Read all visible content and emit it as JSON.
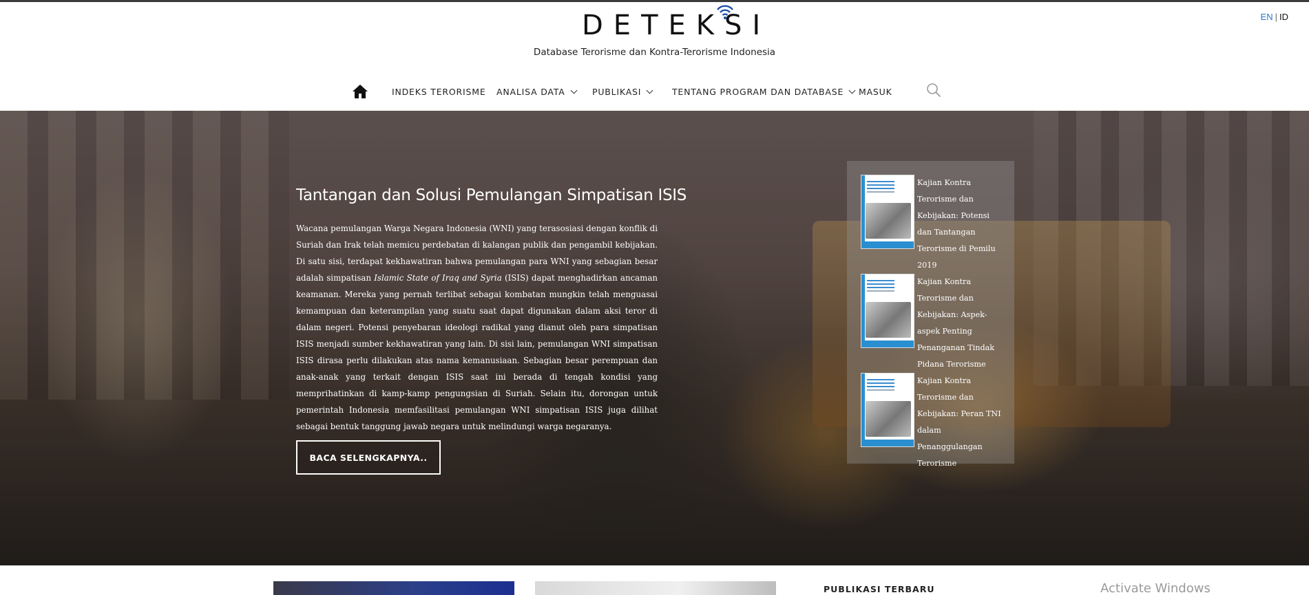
{
  "header": {
    "logo_text": "DETEKSI",
    "tagline": "Database Terorisme dan Kontra-Terorisme Indonesia",
    "lang_en": "EN",
    "lang_sep": "|",
    "lang_id": "ID"
  },
  "nav": {
    "home_icon": "home-icon",
    "items": [
      {
        "label": "INDEKS TERORISME",
        "dropdown": false
      },
      {
        "label": "ANALISA DATA",
        "dropdown": true
      },
      {
        "label": "PUBLIKASI",
        "dropdown": true
      },
      {
        "label": "TENTANG PROGRAM DAN DATABASE",
        "dropdown": true
      },
      {
        "label": "MASUK",
        "dropdown": false
      }
    ],
    "search_icon": "search-icon"
  },
  "hero": {
    "title": "Tantangan dan Solusi Pemulangan Simpatisan ISIS",
    "body_part1": "Wacana pemulangan Warga Negara Indonesia (WNI) yang terasosiasi dengan konflik di Suriah dan Irak telah memicu perdebatan di kalangan publik dan pengambil kebijakan. Di satu sisi, terdapat kekhawatiran bahwa pemulangan para WNI yang sebagian besar adalah simpatisan ",
    "body_italic": "Islamic State of Iraq and Syria",
    "body_part2": " (ISIS) dapat menghadirkan ancaman keamanan. Mereka yang pernah terlibat sebagai kombatan mungkin telah menguasai kemampuan dan keterampilan yang suatu saat dapat digunakan dalam aksi teror di dalam negeri. Potensi penyebaran ideologi radikal yang dianut oleh para simpatisan ISIS menjadi sumber kekhawatiran yang lain. Di sisi lain, pemulangan WNI simpatisan ISIS dirasa perlu dilakukan atas nama kemanusiaan. Sebagian besar perempuan dan anak-anak yang terkait dengan ISIS saat ini berada di tengah kondisi yang memprihatinkan di kamp-kamp pengungsian di Suriah. Selain itu, dorongan untuk pemerintah Indonesia memfasilitasi pemulangan WNI simpatisan ISIS juga dilihat sebagai bentuk tanggung jawab negara untuk melindungi warga negaranya.",
    "read_more": "BACA SELENGKAPNYA.."
  },
  "publications": [
    {
      "title": "Kajian Kontra Terorisme dan Kebijakan: Potensi dan Tantangan Terorisme di Pemilu 2019"
    },
    {
      "title": "Kajian Kontra Terorisme dan Kebijakan: Aspek-aspek Penting Penanganan Tindak Pidana Terorisme"
    },
    {
      "title": "Kajian Kontra Terorisme dan Kebijakan: Peran TNI dalam Penanggulangan Terorisme"
    }
  ],
  "bottom": {
    "latest_heading": "PUBLIKASI TERBARU",
    "watermark": "Activate Windows"
  }
}
